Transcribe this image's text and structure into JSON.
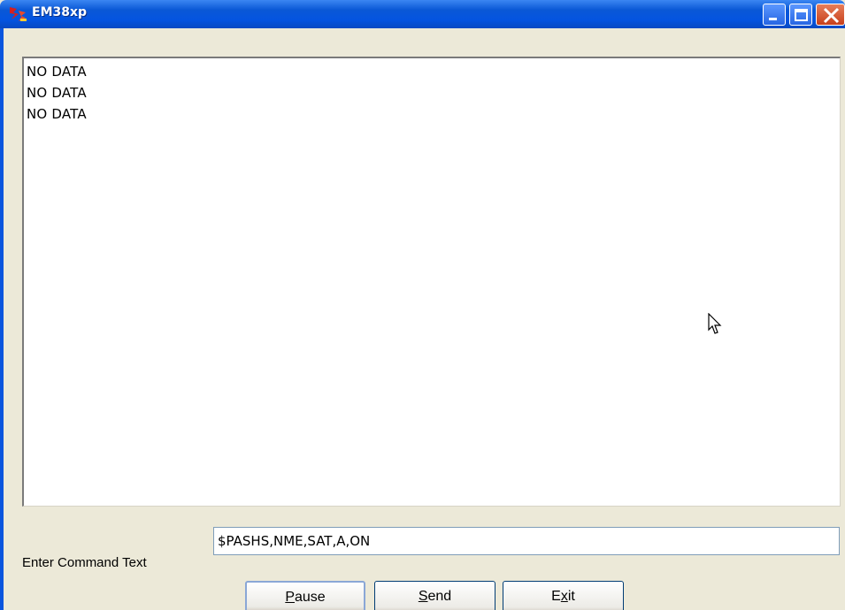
{
  "window": {
    "title": "EM38xp",
    "colors": {
      "titlebar": "#0454e0",
      "face": "#ece9d8",
      "close": "#c7401c"
    }
  },
  "output": {
    "lines": [
      "NO DATA",
      "NO DATA",
      "NO DATA"
    ]
  },
  "command": {
    "label": "Enter Command Text",
    "value": "$PASHS,NME,SAT,A,ON"
  },
  "buttons": {
    "pause": {
      "mnemonic": "P",
      "rest": "ause"
    },
    "send": {
      "mnemonic": "S",
      "rest": "end"
    },
    "exit": {
      "pre": "E",
      "mnemonic": "x",
      "rest": "it"
    }
  }
}
